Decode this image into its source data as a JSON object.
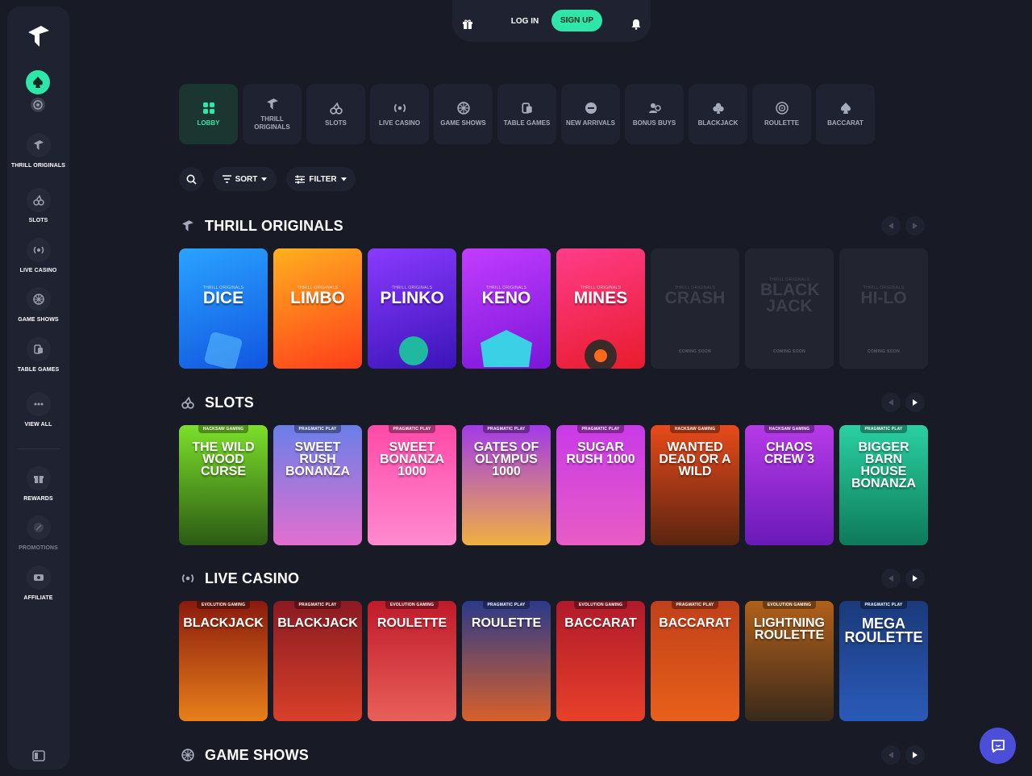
{
  "header": {
    "login_label": "LOG IN",
    "signup_label": "SIGN UP"
  },
  "sidebar": {
    "items": [
      {
        "label": "THRILL ORIGINALS"
      },
      {
        "label": "SLOTS"
      },
      {
        "label": "LIVE CASINO"
      },
      {
        "label": "GAME SHOWS"
      },
      {
        "label": "TABLE GAMES"
      },
      {
        "label": "VIEW ALL"
      }
    ],
    "secondary": [
      {
        "label": "REWARDS"
      },
      {
        "label": "PROMOTIONS"
      },
      {
        "label": "AFFILIATE"
      }
    ]
  },
  "categories": [
    {
      "label": "LOBBY"
    },
    {
      "label": "THRILL ORIGINALS"
    },
    {
      "label": "SLOTS"
    },
    {
      "label": "LIVE CASINO"
    },
    {
      "label": "GAME SHOWS"
    },
    {
      "label": "TABLE GAMES"
    },
    {
      "label": "NEW ARRIVALS"
    },
    {
      "label": "BONUS BUYS"
    },
    {
      "label": "BLACKJACK"
    },
    {
      "label": "ROULETTE"
    },
    {
      "label": "BACCARAT"
    }
  ],
  "toolbar": {
    "sort_label": "SORT",
    "filter_label": "FILTER"
  },
  "sections": {
    "originals": {
      "title": "THRILL ORIGINALS",
      "tag": "THRILL ORIGINALS",
      "coming_soon": "COMING SOON",
      "cards": [
        {
          "title": "DICE"
        },
        {
          "title": "LIMBO"
        },
        {
          "title": "PLINKO"
        },
        {
          "title": "KENO"
        },
        {
          "title": "MINES"
        },
        {
          "title": "CRASH"
        },
        {
          "title": "BLACK JACK"
        },
        {
          "title": "HI-LO"
        }
      ]
    },
    "slots": {
      "title": "SLOTS",
      "cards": [
        {
          "provider": "HACKSAW GAMING",
          "title": "THE WILD WOOD CURSE"
        },
        {
          "provider": "PRAGMATIC PLAY",
          "title": "SWEET RUSH BONANZA"
        },
        {
          "provider": "PRAGMATIC PLAY",
          "title": "SWEET BONANZA 1000"
        },
        {
          "provider": "PRAGMATIC PLAY",
          "title": "GATES OF OLYMPUS 1000"
        },
        {
          "provider": "PRAGMATIC PLAY",
          "title": "SUGAR RUSH 1000"
        },
        {
          "provider": "HACKSAW GAMING",
          "title": "WANTED DEAD OR A WILD"
        },
        {
          "provider": "HACKSAW GAMING",
          "title": "CHAOS CREW 3"
        },
        {
          "provider": "PRAGMATIC PLAY",
          "title": "BIGGER BARN HOUSE BONANZA"
        }
      ]
    },
    "live": {
      "title": "LIVE CASINO",
      "cards": [
        {
          "provider": "EVOLUTION GAMING",
          "title": "BLACKJACK"
        },
        {
          "provider": "PRAGMATIC PLAY",
          "title": "BLACKJACK"
        },
        {
          "provider": "EVOLUTION GAMING",
          "title": "ROULETTE"
        },
        {
          "provider": "PRAGMATIC PLAY",
          "title": "ROULETTE"
        },
        {
          "provider": "EVOLUTION GAMING",
          "title": "BACCARAT"
        },
        {
          "provider": "PRAGMATIC PLAY",
          "title": "BACCARAT"
        },
        {
          "provider": "EVOLUTION GAMING",
          "title": "LIGHTNING ROULETTE"
        },
        {
          "provider": "PRAGMATIC PLAY",
          "title": "MEGA ROULETTE"
        }
      ]
    },
    "gameshows": {
      "title": "GAME SHOWS"
    }
  },
  "colors": {
    "accent": "#2ee6a8",
    "background": "#181b26",
    "panel": "#1f2230",
    "chat": "#4b4fd8"
  }
}
